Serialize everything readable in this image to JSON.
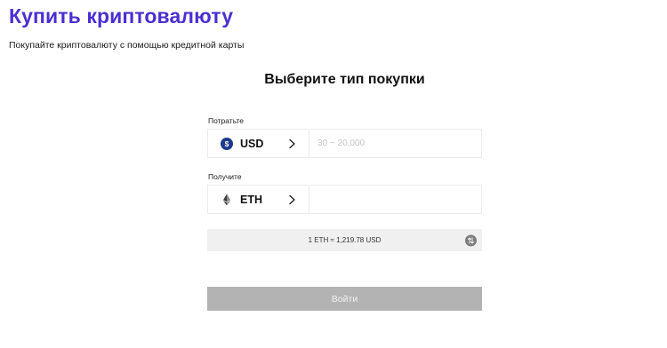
{
  "header": {
    "title": "Купить криптовалюту",
    "subtitle": "Покупайте криптовалюту с помощью кредитной карты"
  },
  "purchase": {
    "section_title": "Выберите тип покупки",
    "spend": {
      "label": "Потратьте",
      "currency_code": "USD",
      "currency_symbol": "$",
      "icon": "usd-coin-icon",
      "amount_value": "",
      "amount_placeholder": "30 ~ 20,000"
    },
    "receive": {
      "label": "Получите",
      "currency_code": "ETH",
      "icon": "ethereum-icon",
      "amount_value": "",
      "amount_placeholder": ""
    },
    "rate_text": "1 ETH ≈ 1,219.78 USD",
    "swap_icon": "swap-vertical-icon",
    "login_label": "Войти"
  },
  "colors": {
    "title": "#4b2fd1",
    "usd_coin": "#1d3a8a",
    "rate_bar": "#f0f0f0",
    "button_disabled": "#b3b3b3"
  }
}
